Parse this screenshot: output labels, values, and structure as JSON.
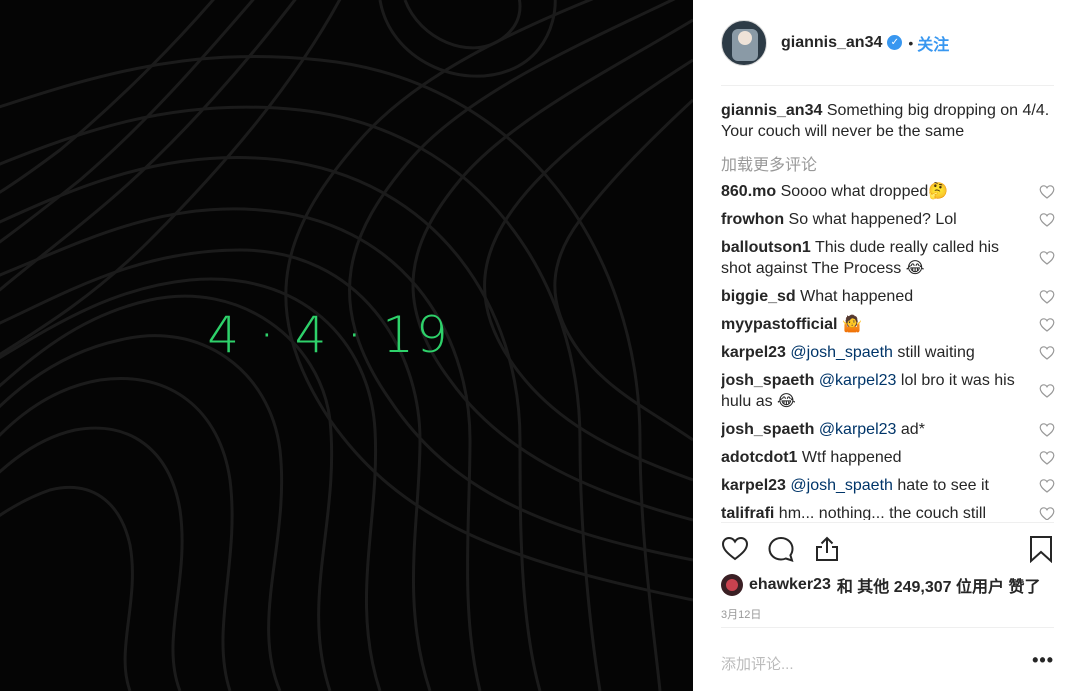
{
  "media": {
    "date_text": "4 · 4 · 19",
    "accent_color": "#2ed16a"
  },
  "header": {
    "username": "giannis_an34",
    "verified_icon": "verified-badge-icon",
    "separator": "•",
    "follow_label": "关注"
  },
  "caption": {
    "username": "giannis_an34",
    "text": "Something big dropping on 4/4. Your couch will never be the same"
  },
  "load_more": "加载更多评论",
  "comments": [
    {
      "user": "860.mo",
      "text": "Soooo what dropped🤔",
      "mention": "",
      "tail": ""
    },
    {
      "user": "frowhon",
      "text": "So what happened? Lol",
      "mention": "",
      "tail": ""
    },
    {
      "user": "balloutson1",
      "text": "This dude really called his shot against The Process 😂",
      "mention": "",
      "tail": ""
    },
    {
      "user": "biggie_sd",
      "text": "What happened",
      "mention": "",
      "tail": ""
    },
    {
      "user": "myypastofficial",
      "text": "🤷",
      "mention": "",
      "tail": ""
    },
    {
      "user": "karpel23",
      "text": "",
      "mention": "@josh_spaeth",
      "tail": "still waiting"
    },
    {
      "user": "josh_spaeth",
      "text": "",
      "mention": "@karpel23",
      "tail": "lol bro it was his hulu as 😂"
    },
    {
      "user": "josh_spaeth",
      "text": "",
      "mention": "@karpel23",
      "tail": "ad*"
    },
    {
      "user": "adotcdot1",
      "text": "Wtf happened",
      "mention": "",
      "tail": ""
    },
    {
      "user": "karpel23",
      "text": "",
      "mention": "@josh_spaeth",
      "tail": "hate to see it"
    },
    {
      "user": "talifrafi",
      "text": "hm... nothing... the couch still",
      "mention": "",
      "tail": ""
    }
  ],
  "actions": {
    "like_icon": "heart-icon",
    "comment_icon": "comment-icon",
    "share_icon": "share-icon",
    "save_icon": "bookmark-icon"
  },
  "likes": {
    "user": "ehawker23",
    "text": "和 其他 249,307 位用户 赞了"
  },
  "timestamp": "3月12日",
  "add_comment": {
    "placeholder": "添加评论...",
    "more_label": "•••"
  }
}
